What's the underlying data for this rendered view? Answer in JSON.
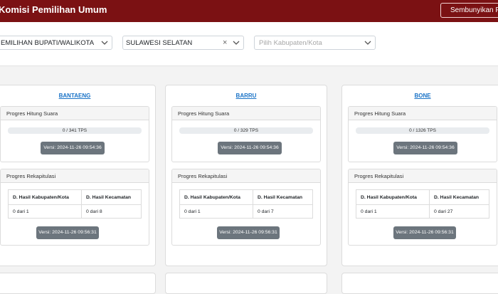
{
  "header": {
    "title": "Komisi Pemilihan Umum",
    "hide_label": "Sembunyikan Filter"
  },
  "filters": {
    "election": "EMILIHAN BUPATI/WALIKOTA",
    "province": "SULAWESI SELATAN",
    "regency_placeholder": "Pilih Kabupaten/Kota"
  },
  "cards": [
    {
      "name": "BANTAENG",
      "count_title": "Progres Hitung Suara",
      "count_progress": "0 / 341 TPS",
      "count_version": "Versi: 2024-11-26 09:54:36",
      "recap_title": "Progres Rekapitulasi",
      "col1": "D. Hasil Kabupaten/Kota",
      "col2": "D. Hasil Kecamatan",
      "val1": "0 dari 1",
      "val2": "0 dari 8",
      "recap_version": "Versi: 2024-11-26 09:56:31"
    },
    {
      "name": "BARRU",
      "count_title": "Progres Hitung Suara",
      "count_progress": "0 / 329 TPS",
      "count_version": "Versi: 2024-11-26 09:54:36",
      "recap_title": "Progres Rekapitulasi",
      "col1": "D. Hasil Kabupaten/Kota",
      "col2": "D. Hasil Kecamatan",
      "val1": "0 dari 1",
      "val2": "0 dari 7",
      "recap_version": "Versi: 2024-11-26 09:56:31"
    },
    {
      "name": "BONE",
      "count_title": "Progres Hitung Suara",
      "count_progress": "0 / 1326 TPS",
      "count_version": "Versi: 2024-11-26 09:54:36",
      "recap_title": "Progres Rekapitulasi",
      "col1": "D. Hasil Kabupaten/Kota",
      "col2": "D. Hasil Kecamatan",
      "val1": "0 dari 1",
      "val2": "0 dari 27",
      "recap_version": "Versi: 2024-11-26 09:56:31"
    }
  ],
  "colors": {
    "header_bg": "#7b1113",
    "link": "#1a73c7",
    "badge_bg": "#6c757d"
  },
  "icons": {
    "filter": "filter-icon",
    "chevron": "chevron-down-icon",
    "clear": "clear-icon"
  }
}
